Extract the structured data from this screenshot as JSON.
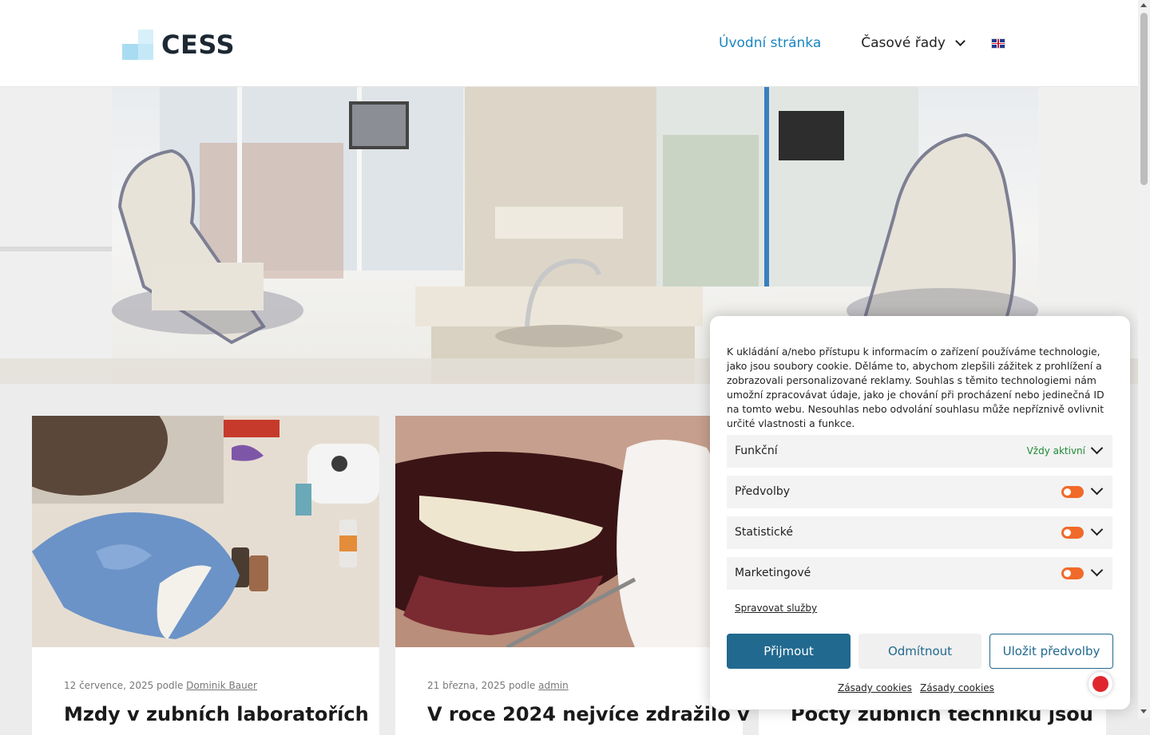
{
  "header": {
    "logo_text": "CESS",
    "nav": {
      "home": "Úvodní stránka",
      "time_series": "Časové řady"
    },
    "language": "en-flag-icon"
  },
  "cards": [
    {
      "date": "12 července, 2025 podle",
      "author": "Dominik Bauer",
      "title": "Mzdy v zubních laboratořích"
    },
    {
      "date": "21 března, 2025 podle",
      "author": "admin",
      "title": "V roce 2024 nejvíce zdražilo v"
    },
    {
      "date": "",
      "author": "",
      "title": "Počty zubních techniků jsou"
    }
  ],
  "cookie": {
    "text": "K ukládání a/nebo přístupu k informacím o zařízení používáme technologie, jako jsou soubory cookie. Děláme to, abychom zlepšili zážitek z prohlížení a zobrazovali personalizované reklamy. Souhlas s těmito technologiemi nám umožní zpracovávat údaje, jako je chování při procházení nebo jedinečná ID na tomto webu. Nesouhlas nebo odvolání souhlasu může nepříznivě ovlivnit určité vlastnosti a funkce.",
    "categories": [
      {
        "label": "Funkční",
        "status": "Vždy aktivní"
      },
      {
        "label": "Předvolby"
      },
      {
        "label": "Statistické"
      },
      {
        "label": "Marketingové"
      }
    ],
    "manage_services": "Spravovat služby",
    "accept": "Přijmout",
    "reject": "Odmítnout",
    "save": "Uložit předvolby",
    "policy_links": [
      "Zásady cookies",
      "Zásady cookies"
    ],
    "toggle_color": "#f06a2a",
    "accent_color": "#21698f"
  }
}
